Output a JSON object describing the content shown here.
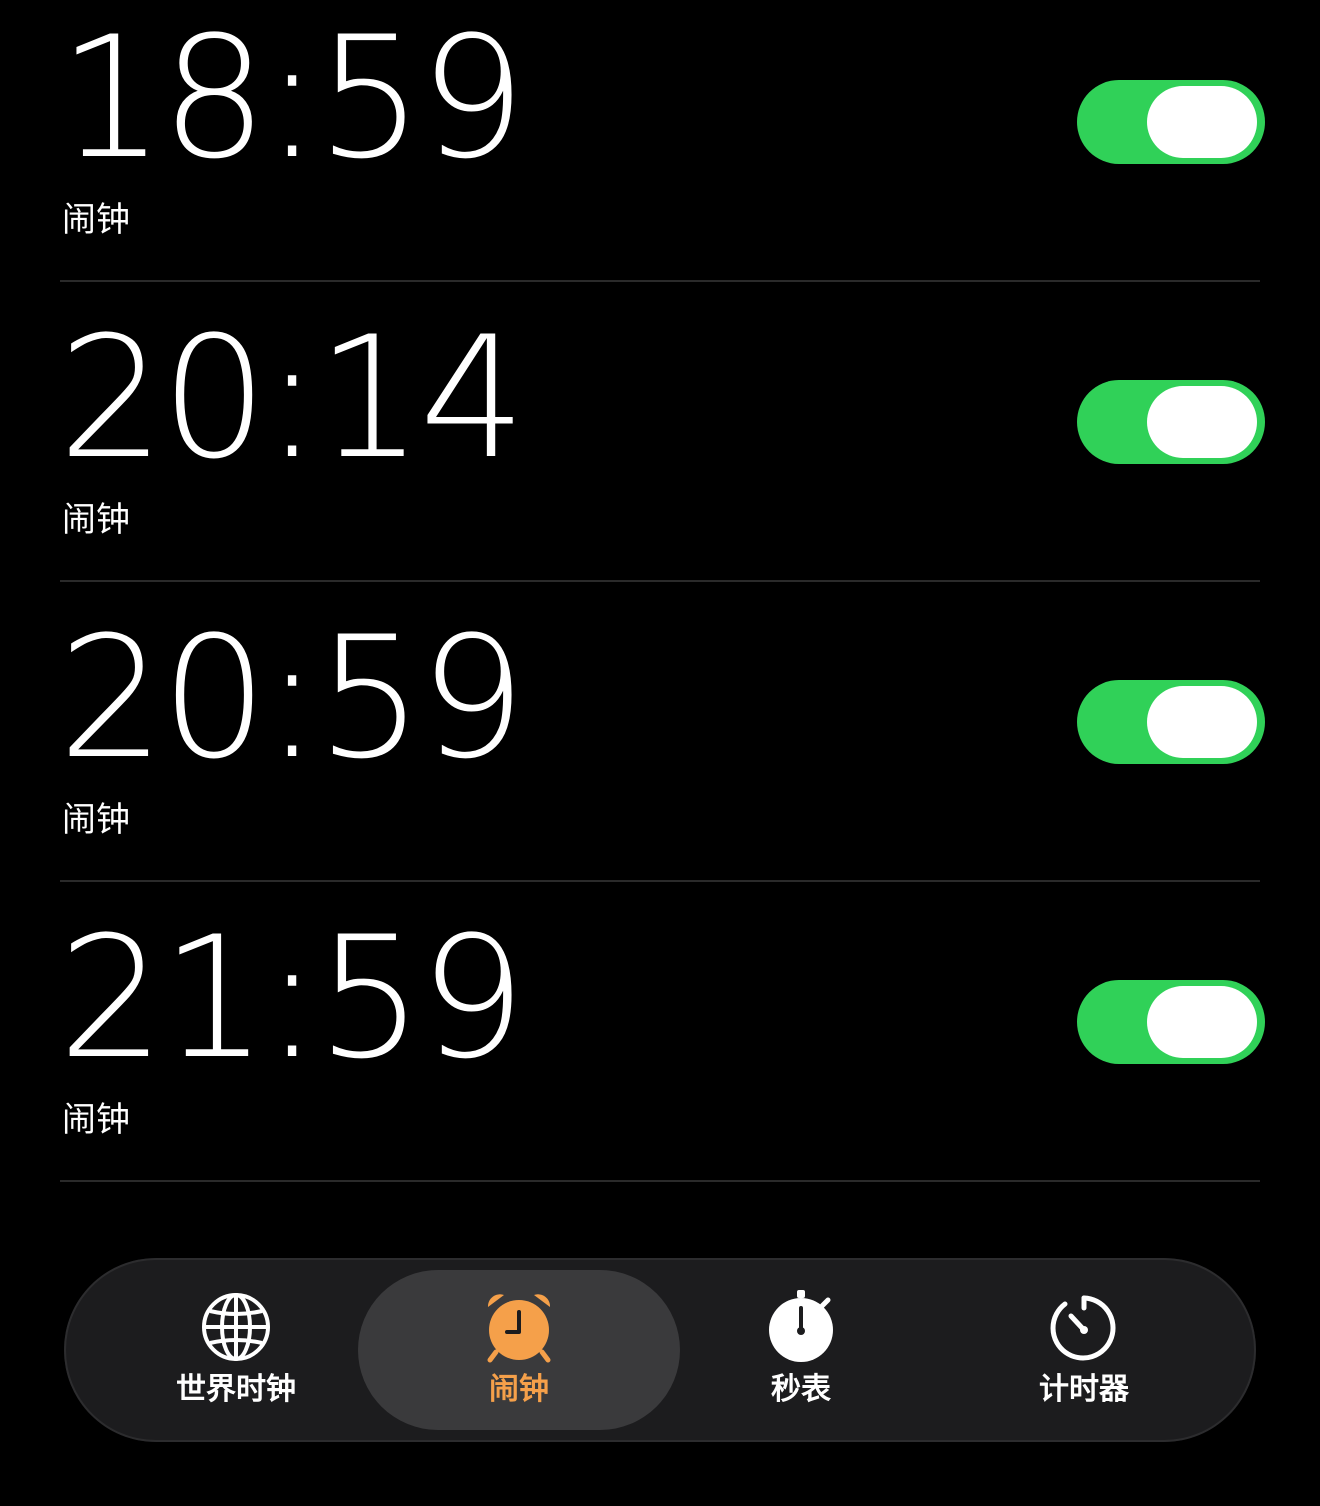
{
  "alarms": [
    {
      "time": "18:59",
      "label": "闹钟",
      "enabled": true
    },
    {
      "time": "20:14",
      "label": "闹钟",
      "enabled": true
    },
    {
      "time": "20:59",
      "label": "闹钟",
      "enabled": true
    },
    {
      "time": "21:59",
      "label": "闹钟",
      "enabled": true
    }
  ],
  "tabs": [
    {
      "label": "世界时钟",
      "icon": "globe-icon",
      "selected": false
    },
    {
      "label": "闹钟",
      "icon": "alarm-clock-icon",
      "selected": true
    },
    {
      "label": "秒表",
      "icon": "stopwatch-icon",
      "selected": false
    },
    {
      "label": "计时器",
      "icon": "timer-icon",
      "selected": false
    }
  ],
  "colors": {
    "background": "#000000",
    "toggle_on": "#30d158",
    "accent": "#f5a04a",
    "tab_bar": "#1c1c1e",
    "tab_selected": "#3a3a3c",
    "separator": "#2a2a2a"
  }
}
